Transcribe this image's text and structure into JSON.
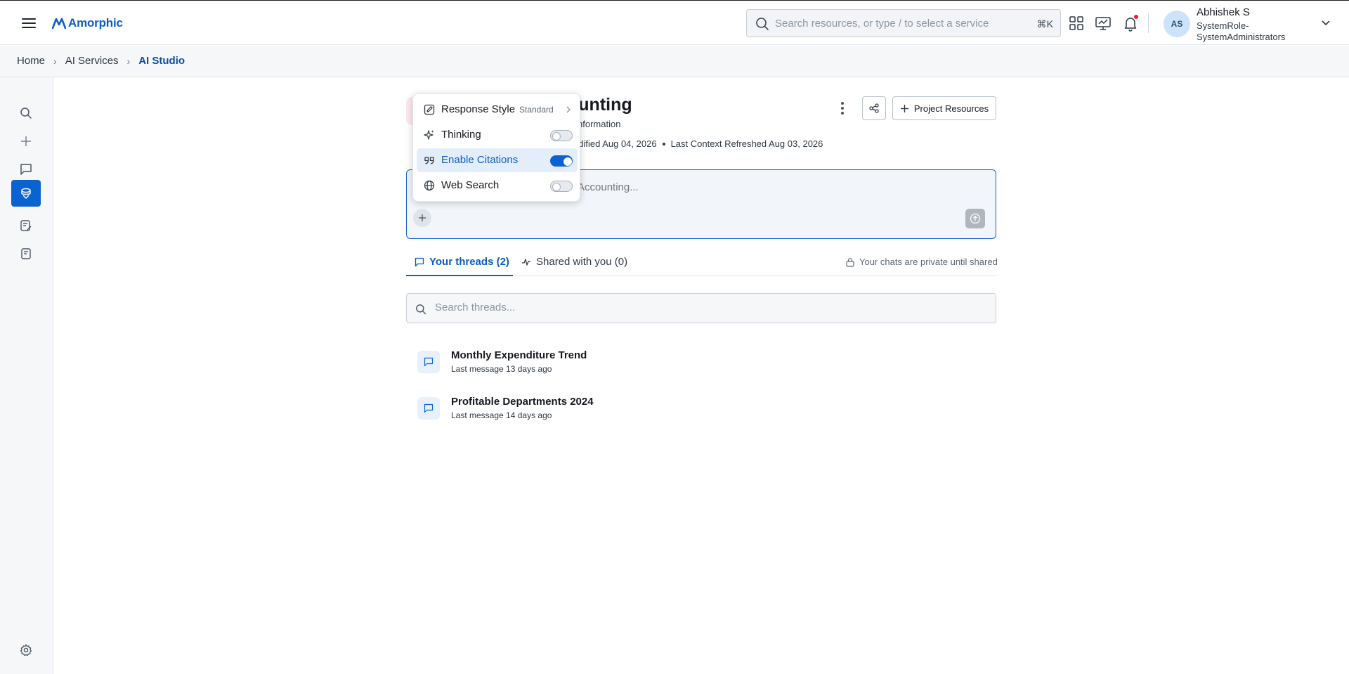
{
  "app": {
    "logo_text": "Amorphic",
    "search_placeholder": "Search resources, or type / to select a service",
    "search_shortcut": "⌘K"
  },
  "user": {
    "initials": "AS",
    "name": "Abhishek S",
    "role": "SystemRole-SystemAdministrators"
  },
  "breadcrumb": {
    "items": [
      "Home",
      "AI Services",
      "AI Studio"
    ]
  },
  "project": {
    "title_visible": "ounting",
    "subtitle_visible": "nformation",
    "modified_visible": "odified Aug 04, 2026",
    "last_refreshed": "Last Context Refreshed Aug 03, 2026",
    "resources_label": "Project Resources"
  },
  "prompt": {
    "placeholder_visible": "Accounting..."
  },
  "menu": {
    "items": [
      {
        "label": "Response Style",
        "value": "Standard",
        "type": "submenu"
      },
      {
        "label": "Thinking",
        "type": "toggle",
        "enabled": false
      },
      {
        "label": "Enable Citations",
        "type": "toggle",
        "enabled": true
      },
      {
        "label": "Web Search",
        "type": "toggle",
        "enabled": false
      }
    ]
  },
  "tabs": [
    {
      "label": "Your threads (2)",
      "active": true
    },
    {
      "label": "Shared with you (0)",
      "active": false
    }
  ],
  "privacy_note": "Your chats are private until shared",
  "thread_search": {
    "placeholder": "Search threads..."
  },
  "threads": [
    {
      "title": "Monthly Expenditure Trend",
      "subtitle": "Last message 13 days ago"
    },
    {
      "title": "Profitable Departments 2024",
      "subtitle": "Last message 14 days ago"
    }
  ],
  "colors": {
    "accent": "#0b63d1",
    "brand": "#0a5ec8",
    "notification": "#e0242f"
  }
}
